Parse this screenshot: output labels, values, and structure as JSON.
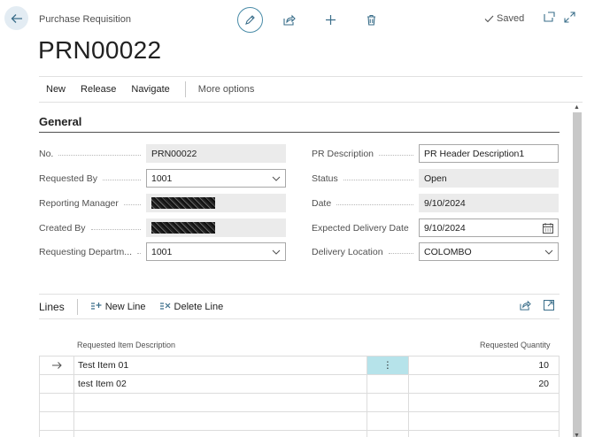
{
  "header": {
    "caption": "Purchase Requisition",
    "title": "PRN00022",
    "saved_label": "Saved"
  },
  "actions": {
    "new": "New",
    "release": "Release",
    "navigate": "Navigate",
    "more": "More options"
  },
  "general": {
    "title": "General",
    "no": {
      "label": "No.",
      "value": "PRN00022"
    },
    "requested_by": {
      "label": "Requested By",
      "value": "1001"
    },
    "reporting_manager": {
      "label": "Reporting Manager"
    },
    "created_by": {
      "label": "Created By"
    },
    "requesting_department": {
      "label": "Requesting Departm...",
      "value": "1001"
    },
    "pr_description": {
      "label": "PR Description",
      "value": "PR Header Description1"
    },
    "status": {
      "label": "Status",
      "value": "Open"
    },
    "date": {
      "label": "Date",
      "value": "9/10/2024"
    },
    "expected_delivery_date": {
      "label": "Expected Delivery Date",
      "value": "9/10/2024"
    },
    "delivery_location": {
      "label": "Delivery Location",
      "value": "COLOMBO"
    }
  },
  "lines": {
    "title": "Lines",
    "new_line": "New Line",
    "delete_line": "Delete Line",
    "columns": {
      "description": "Requested Item Description",
      "quantity": "Requested Quantity"
    },
    "rows": [
      {
        "description": "Test Item 01",
        "quantity": "10"
      },
      {
        "description": "test Item 02",
        "quantity": "20"
      },
      {
        "description": "",
        "quantity": ""
      },
      {
        "description": "",
        "quantity": ""
      },
      {
        "description": "",
        "quantity": ""
      }
    ]
  },
  "colors": {
    "accent": "#4a8ca8",
    "back_button_bg": "#e3ecf3",
    "active_cell": "#b6e3ea",
    "readonly_field": "#ebebeb"
  },
  "icons": {
    "back": "arrow-left-icon",
    "edit": "pencil-icon",
    "share": "share-icon",
    "add": "plus-icon",
    "delete": "trash-icon",
    "saved": "checkmark-icon",
    "open_new": "open-in-new-window-icon",
    "expand": "expand-icon",
    "calendar": "calendar-icon",
    "dropdown": "chevron-down-icon",
    "row_selector": "arrow-right-icon",
    "row_menu": "vertical-ellipsis-icon"
  }
}
